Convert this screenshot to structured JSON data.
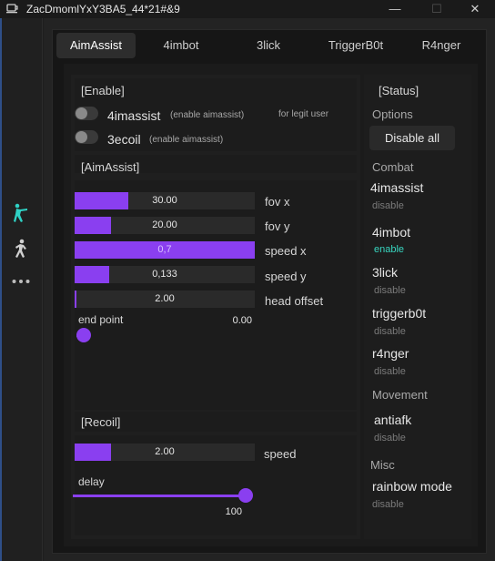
{
  "window": {
    "title": "ZacDmomlYxY3BA5_44*21#&9",
    "minimize": "—",
    "maximize": "☐",
    "close": "✕"
  },
  "tabs": [
    {
      "label": "AimAssist",
      "active": true
    },
    {
      "label": "4imbot",
      "active": false
    },
    {
      "label": "3lick",
      "active": false
    },
    {
      "label": "TriggerB0t",
      "active": false
    },
    {
      "label": "R4nger",
      "active": false
    }
  ],
  "enable": {
    "title": "[Enable]",
    "items": [
      {
        "label": "4imassist",
        "hint": "(enable aimassist)",
        "note": "for legit user",
        "on": false
      },
      {
        "label": "3ecoil",
        "hint": "(enable aimassist)",
        "on": false
      }
    ]
  },
  "aimassist": {
    "title": "[AimAssist]",
    "bars": [
      {
        "value_text": "30.00",
        "label": "fov x",
        "fill": 0.3
      },
      {
        "value_text": "20.00",
        "label": "fov y",
        "fill": 0.2
      },
      {
        "value_text": "0,7",
        "label": "speed x",
        "fill": 1.0
      },
      {
        "value_text": "0,133",
        "label": "speed y",
        "fill": 0.19
      },
      {
        "value_text": "2.00",
        "label": "head offset",
        "fill": 0.01
      }
    ],
    "end_point": {
      "label": "end point",
      "value": "0.00",
      "level": 0.0
    }
  },
  "recoil": {
    "title": "[Recoil]",
    "speed": {
      "value_text": "2.00",
      "label": "speed",
      "fill": 0.2
    },
    "delay": {
      "label": "delay",
      "value": "100",
      "level": 1.0
    }
  },
  "status": {
    "title": "[Status]",
    "options_head": "Options",
    "disable_all": "Disable all",
    "combat_head": "Combat",
    "combat": [
      {
        "name": "4imassist",
        "state": "disable"
      },
      {
        "name": "4imbot",
        "state": "enable"
      },
      {
        "name": "3lick",
        "state": "disable"
      },
      {
        "name": "triggerb0t",
        "state": "disable"
      },
      {
        "name": "r4nger",
        "state": "disable"
      }
    ],
    "movement_head": "Movement",
    "movement": [
      {
        "name": "antiafk",
        "state": "disable"
      }
    ],
    "misc_head": "Misc",
    "misc": [
      {
        "name": "rainbow mode",
        "state": "disable"
      }
    ]
  },
  "sidebar_icons": [
    "shooter-icon",
    "walker-icon",
    "more-icon"
  ],
  "colors": {
    "accent": "#8a3ff0",
    "enabled": "#38d6c0",
    "active_icon": "#2fd1c4"
  }
}
